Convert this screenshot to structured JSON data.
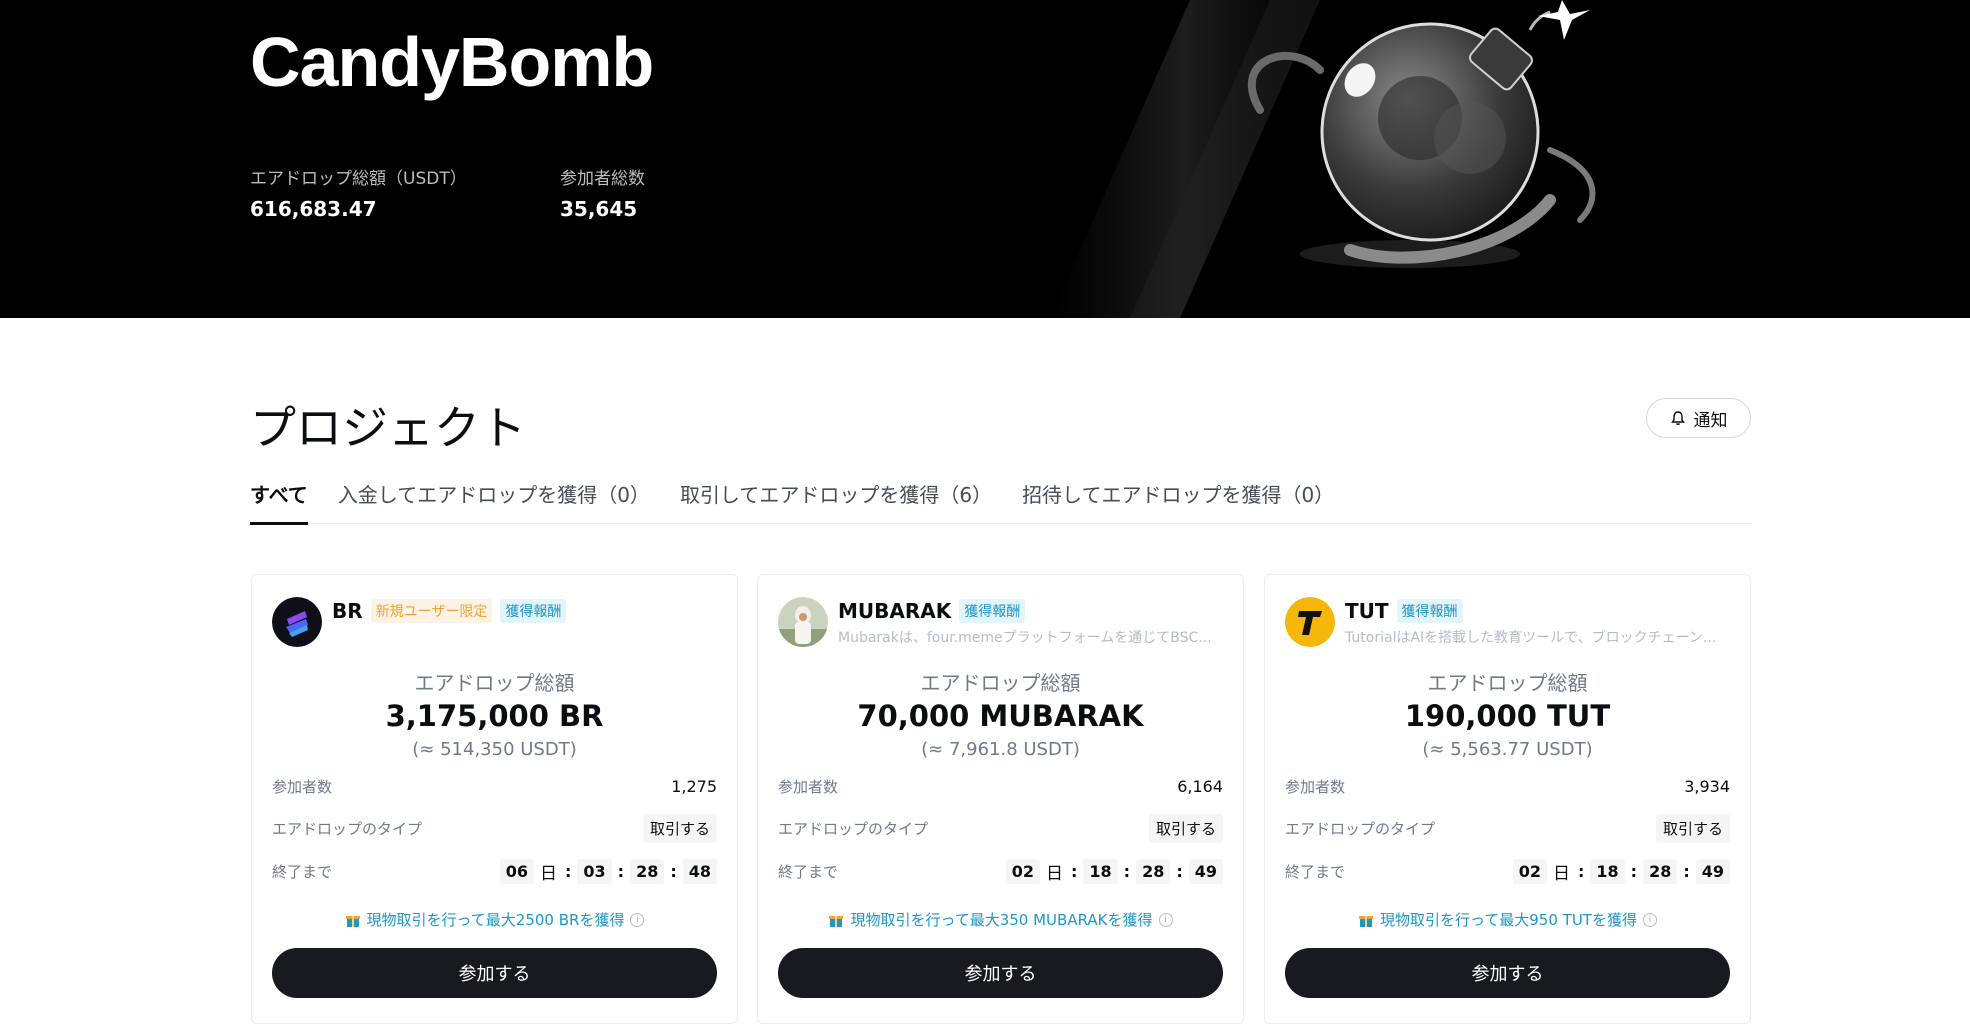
{
  "hero": {
    "title": "CandyBomb",
    "stats": [
      {
        "label": "エアドロップ総額（USDT）",
        "value": "616,683.47"
      },
      {
        "label": "参加者総数",
        "value": "35,645"
      }
    ]
  },
  "section": {
    "title": "プロジェクト",
    "notify_label": "通知",
    "tabs": [
      {
        "label": "すべて",
        "active": true
      },
      {
        "label": "入金してエアドロップを獲得（0）",
        "active": false
      },
      {
        "label": "取引してエアドロップを獲得（6）",
        "active": false
      },
      {
        "label": "招待してエアドロップを獲得（0）",
        "active": false
      }
    ]
  },
  "cards": [
    {
      "name": "BR",
      "badges": [
        "新規ユーザー限定",
        "獲得報酬"
      ],
      "description": "",
      "total_label": "エアドロップ総額",
      "total_amount": "3,175,000 BR",
      "total_usdt": "(≈ 514,350 USDT)",
      "participants_label": "参加者数",
      "participants": "1,275",
      "type_label": "エアドロップのタイプ",
      "type": "取引する",
      "ends_label": "終了まで",
      "countdown": {
        "days": "06",
        "day_unit": "日",
        "hours": "03",
        "minutes": "28",
        "seconds": "48"
      },
      "promo": "現物取引を行って最大2500 BRを獲得",
      "join_label": "参加する"
    },
    {
      "name": "MUBARAK",
      "badges": [
        "獲得報酬"
      ],
      "description": "Mubarakは、four.memeプラットフォームを通じてBSC...",
      "total_label": "エアドロップ総額",
      "total_amount": "70,000 MUBARAK",
      "total_usdt": "(≈ 7,961.8 USDT)",
      "participants_label": "参加者数",
      "participants": "6,164",
      "type_label": "エアドロップのタイプ",
      "type": "取引する",
      "ends_label": "終了まで",
      "countdown": {
        "days": "02",
        "day_unit": "日",
        "hours": "18",
        "minutes": "28",
        "seconds": "49"
      },
      "promo": "現物取引を行って最大350 MUBARAKを獲得",
      "join_label": "参加する"
    },
    {
      "name": "TUT",
      "badges": [
        "獲得報酬"
      ],
      "description": "TutorialはAIを搭載した教育ツールで、ブロックチェーン...",
      "total_label": "エアドロップ総額",
      "total_amount": "190,000 TUT",
      "total_usdt": "(≈ 5,563.77 USDT)",
      "participants_label": "参加者数",
      "participants": "3,934",
      "type_label": "エアドロップのタイプ",
      "type": "取引する",
      "ends_label": "終了まで",
      "countdown": {
        "days": "02",
        "day_unit": "日",
        "hours": "18",
        "minutes": "28",
        "seconds": "49"
      },
      "promo": "現物取引を行って最大950 TUTを獲得",
      "join_label": "参加する"
    }
  ],
  "colors": {
    "accent": "#1e97c5",
    "badge_orange": "#f0a33a",
    "button": "#181a20"
  },
  "icons": [
    "bomb-illustration",
    "bell-icon",
    "gift-icon",
    "info-icon"
  ]
}
